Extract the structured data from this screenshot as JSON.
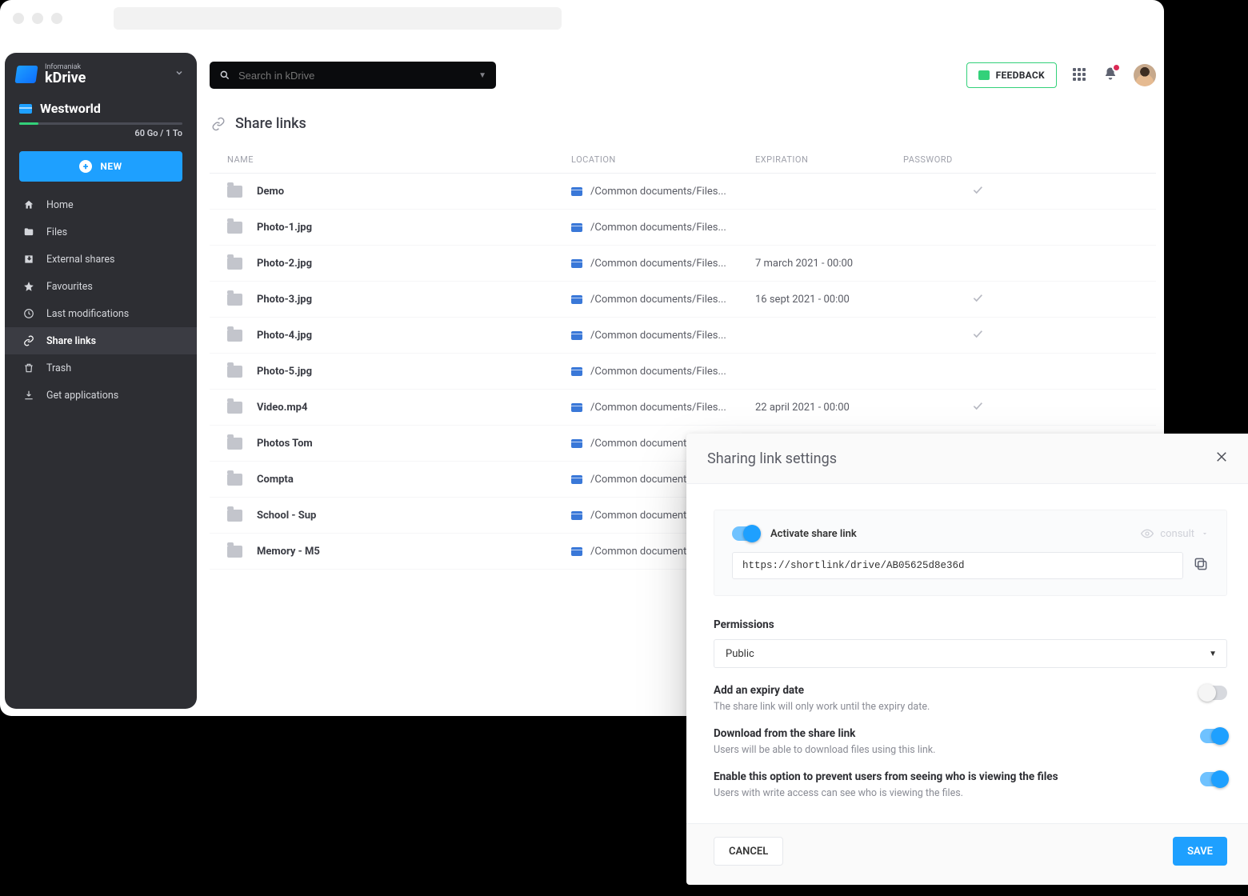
{
  "brand": {
    "sup": "Infomaniak",
    "name": "kDrive"
  },
  "drive": {
    "name": "Westworld",
    "quota": "60 Go / 1 To"
  },
  "newButton": "NEW",
  "nav": [
    {
      "label": "Home",
      "icon": "home"
    },
    {
      "label": "Files",
      "icon": "folder"
    },
    {
      "label": "External shares",
      "icon": "incoming"
    },
    {
      "label": "Favourites",
      "icon": "star"
    },
    {
      "label": "Last modifications",
      "icon": "clock"
    },
    {
      "label": "Share links",
      "icon": "link",
      "active": true
    },
    {
      "label": "Trash",
      "icon": "trash"
    },
    {
      "label": "Get applications",
      "icon": "download"
    }
  ],
  "search": {
    "placeholder": "Search in kDrive"
  },
  "feedbackLabel": "FEEDBACK",
  "notificationCount": "1",
  "pageTitle": "Share links",
  "columns": {
    "name": "NAME",
    "location": "LOCATION",
    "expiration": "EXPIRATION",
    "password": "PASSWORD"
  },
  "rows": [
    {
      "name": "Demo",
      "location": "/Common documents/Files...",
      "expiration": "",
      "password": true
    },
    {
      "name": "Photo-1.jpg",
      "location": "/Common documents/Files...",
      "expiration": "",
      "password": false
    },
    {
      "name": "Photo-2.jpg",
      "location": "/Common documents/Files...",
      "expiration": "7 march 2021 - 00:00",
      "password": false
    },
    {
      "name": "Photo-3.jpg",
      "location": "/Common documents/Files...",
      "expiration": "16 sept 2021 - 00:00",
      "password": true
    },
    {
      "name": "Photo-4.jpg",
      "location": "/Common documents/Files...",
      "expiration": "",
      "password": true
    },
    {
      "name": "Photo-5.jpg",
      "location": "/Common documents/Files...",
      "expiration": "",
      "password": false
    },
    {
      "name": "Video.mp4",
      "location": "/Common documents/Files...",
      "expiration": "22 april 2021 - 00:00",
      "password": true
    },
    {
      "name": "Photos Tom",
      "location": "/Common documents/File",
      "expiration": "",
      "password": false
    },
    {
      "name": "Compta",
      "location": "/Common documents/File",
      "expiration": "",
      "password": false
    },
    {
      "name": "School - Sup",
      "location": "/Common documents/File",
      "expiration": "",
      "password": false
    },
    {
      "name": "Memory - M5",
      "location": "/Common documents/File",
      "expiration": "",
      "password": false
    }
  ],
  "dialog": {
    "title": "Sharing link settings",
    "activateLabel": "Activate share link",
    "consultLabel": "consult",
    "url": "https://shortlink/drive/AB05625d8e36d",
    "permTitle": "Permissions",
    "permValue": "Public",
    "opts": [
      {
        "title": "Add an expiry date",
        "desc": "The share link will only work until the expiry date.",
        "on": false
      },
      {
        "title": "Download from the share link",
        "desc": "Users will be able to download files using this link.",
        "on": true
      },
      {
        "title": "Enable this option to prevent users from seeing who is viewing the files",
        "desc": "Users with write access can see who is viewing the files.",
        "on": true
      }
    ],
    "cancel": "CANCEL",
    "save": "SAVE"
  }
}
